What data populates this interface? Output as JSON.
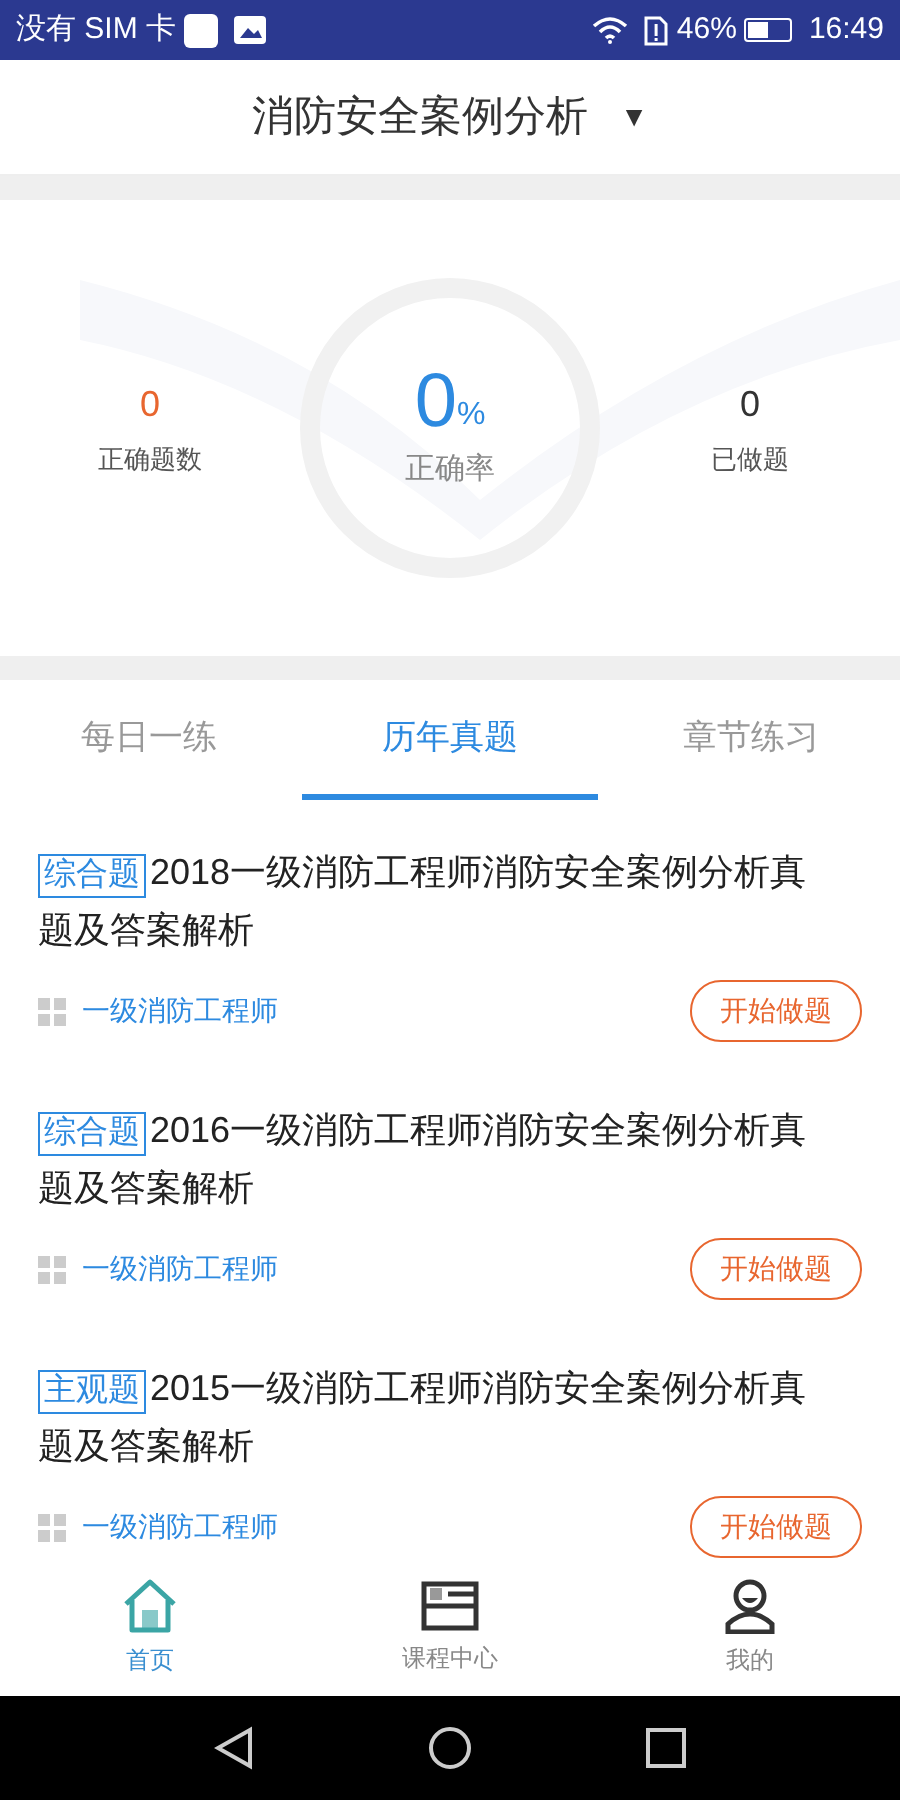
{
  "status_bar": {
    "carrier": "没有 SIM 卡",
    "battery_text": "46%",
    "time": "16:49"
  },
  "header": {
    "title": "消防安全案例分析",
    "dropdown": "▼"
  },
  "stats": {
    "correct_count": {
      "value": "0",
      "label": "正确题数"
    },
    "accuracy": {
      "value": "0",
      "unit": "%",
      "label": "正确率"
    },
    "done": {
      "value": "0",
      "label": "已做题"
    }
  },
  "tabs": [
    {
      "label": "每日一练",
      "selected": false
    },
    {
      "label": "历年真题",
      "selected": true
    },
    {
      "label": "章节练习",
      "selected": false
    }
  ],
  "papers": [
    {
      "tag": "综合题",
      "title": "2018一级消防工程师消防安全案例分析真题及答案解析",
      "category": "一级消防工程师",
      "action": "开始做题"
    },
    {
      "tag": "综合题",
      "title": "2016一级消防工程师消防安全案例分析真题及答案解析",
      "category": "一级消防工程师",
      "action": "开始做题"
    },
    {
      "tag": "主观题",
      "title": "2015一级消防工程师消防安全案例分析真题及答案解析",
      "category": "一级消防工程师",
      "action": "开始做题"
    }
  ],
  "bottom_nav": [
    {
      "label": "首页",
      "kind": "home",
      "selected": true
    },
    {
      "label": "课程中心",
      "kind": "course",
      "selected": false
    },
    {
      "label": "我的",
      "kind": "profile",
      "selected": false
    }
  ]
}
